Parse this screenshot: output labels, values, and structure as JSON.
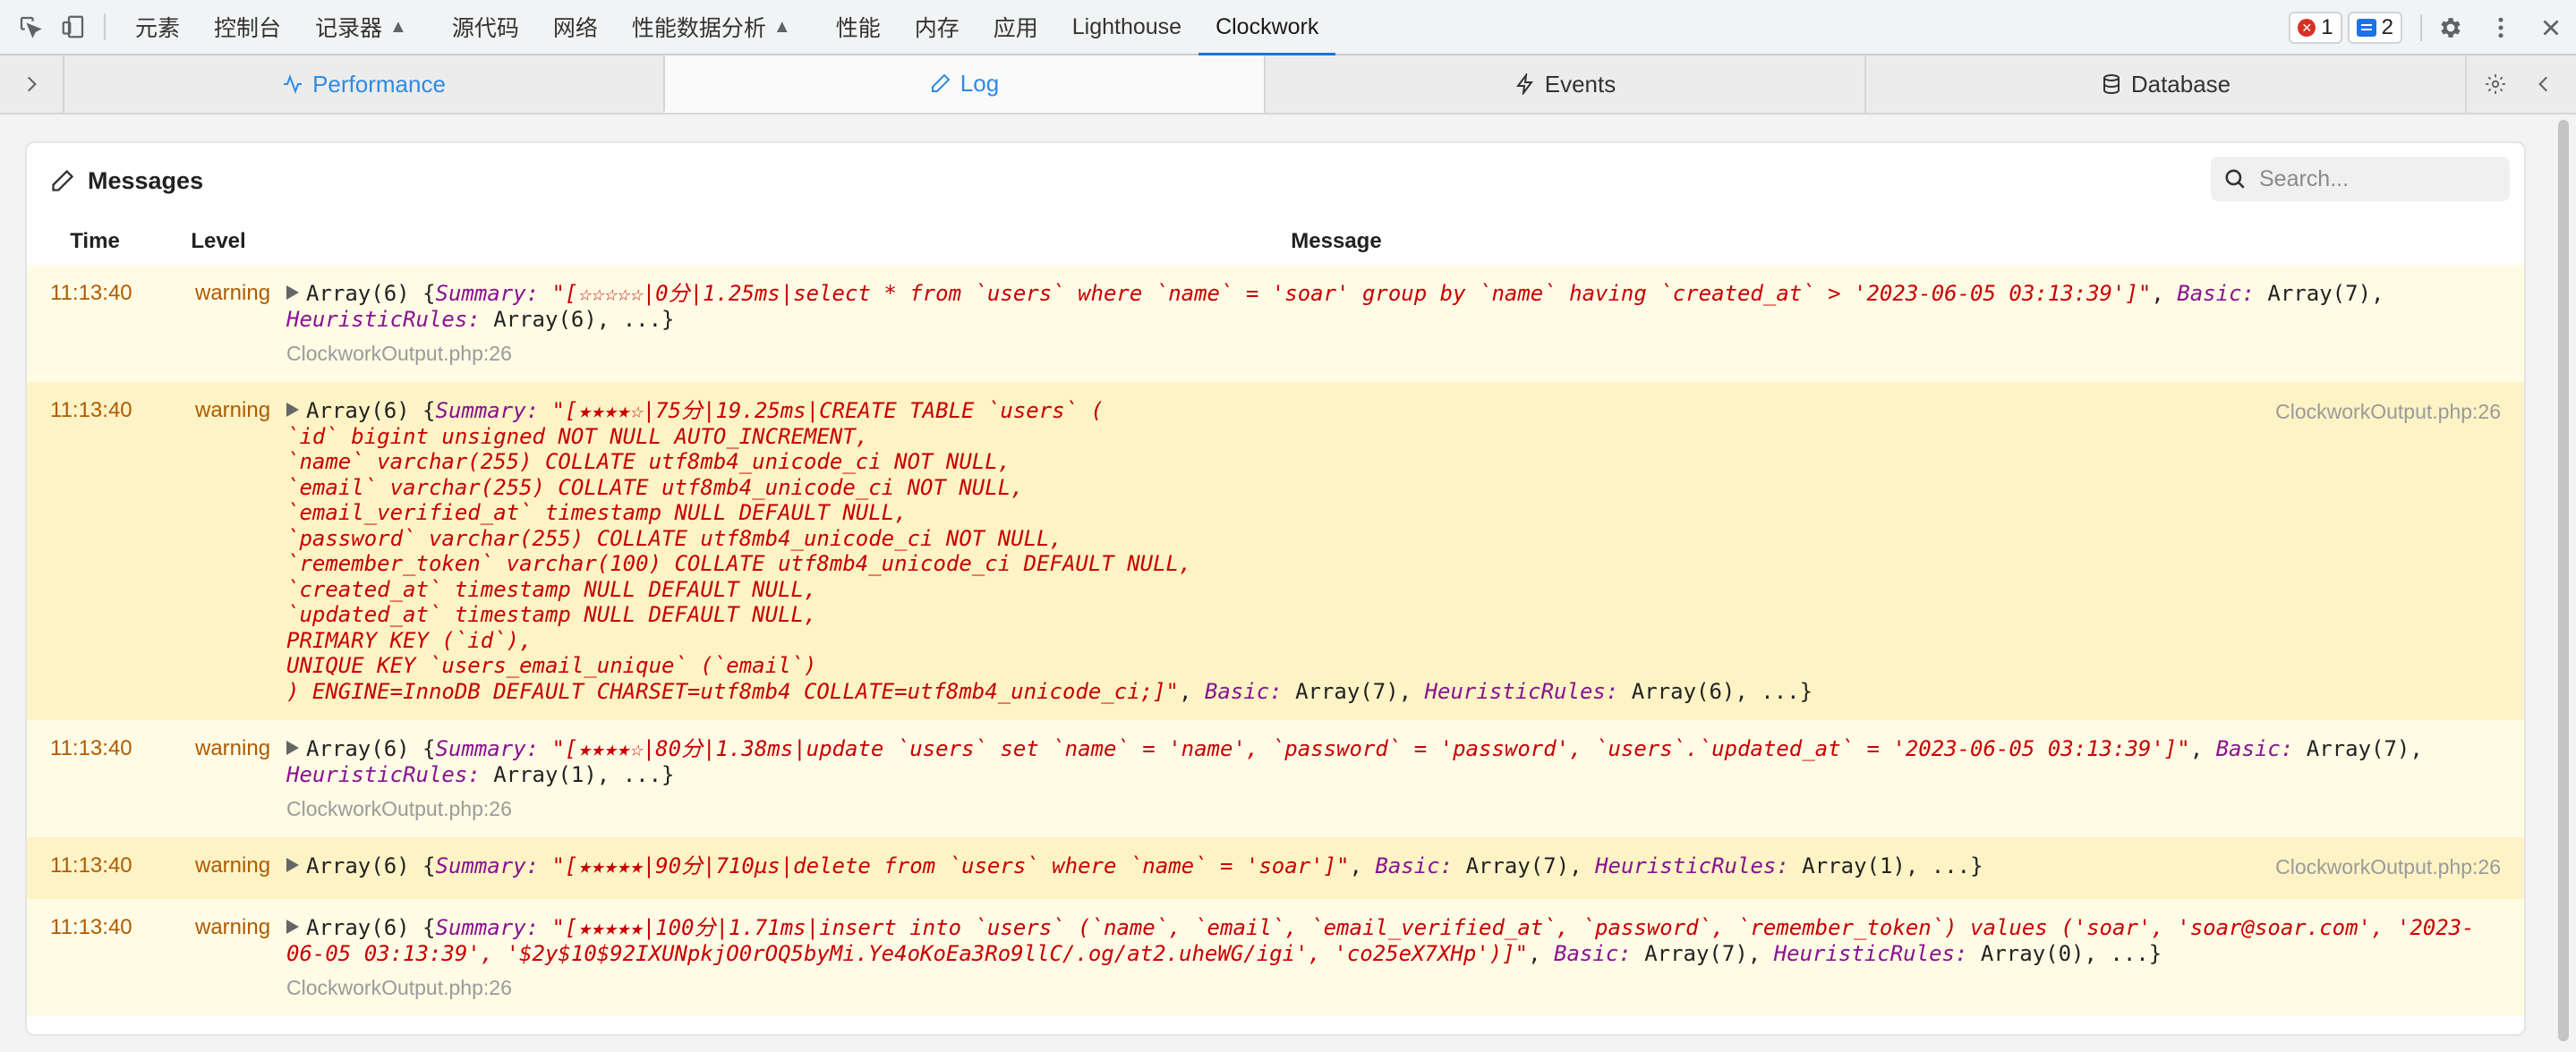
{
  "devtools": {
    "tabs": [
      "元素",
      "控制台",
      "记录器",
      "源代码",
      "网络",
      "性能数据分析",
      "性能",
      "内存",
      "应用",
      "Lighthouse",
      "Clockwork"
    ],
    "experimental_tabs": [
      "记录器",
      "性能数据分析"
    ],
    "active_tab": "Clockwork",
    "error_count": "1",
    "message_count": "2"
  },
  "clockwork": {
    "tabs": {
      "performance": "Performance",
      "log": "Log",
      "events": "Events",
      "database": "Database"
    }
  },
  "panel": {
    "title": "Messages",
    "search_placeholder": "Search...",
    "columns": {
      "time": "Time",
      "level": "Level",
      "message": "Message"
    }
  },
  "messages": [
    {
      "time": "11:13:40",
      "level": "warning",
      "prefix": "Array(6) {",
      "summary_key": "Summary:",
      "summary": "\"[☆☆☆☆☆|0分|1.25ms|select * from `users` where `name` = 'soar' group by `name` having `created_at` > '2023-06-05 03:13:39']\"",
      "basic_key": "Basic:",
      "basic_val": "Array(7),",
      "heuristic_key": "HeuristicRules:",
      "heuristic_val": "Array(6), ...}",
      "source": "ClockworkOutput.php:26"
    },
    {
      "time": "11:13:40",
      "level": "warning",
      "prefix": "Array(6) {",
      "summary_key": "Summary:",
      "summary": "\"[★★★★☆|75分|19.25ms|CREATE TABLE `users` (\n`id` bigint unsigned NOT NULL AUTO_INCREMENT,\n`name` varchar(255) COLLATE utf8mb4_unicode_ci NOT NULL,\n`email` varchar(255) COLLATE utf8mb4_unicode_ci NOT NULL,\n`email_verified_at` timestamp NULL DEFAULT NULL,\n`password` varchar(255) COLLATE utf8mb4_unicode_ci NOT NULL,\n`remember_token` varchar(100) COLLATE utf8mb4_unicode_ci DEFAULT NULL,\n`created_at` timestamp NULL DEFAULT NULL,\n`updated_at` timestamp NULL DEFAULT NULL,\nPRIMARY KEY (`id`),\nUNIQUE KEY `users_email_unique` (`email`)\n) ENGINE=InnoDB DEFAULT CHARSET=utf8mb4 COLLATE=utf8mb4_unicode_ci;]\"",
      "basic_key": "Basic:",
      "basic_val": "Array(7),",
      "heuristic_key": "HeuristicRules:",
      "heuristic_val": "Array(6), ...}",
      "source": "ClockworkOutput.php:26"
    },
    {
      "time": "11:13:40",
      "level": "warning",
      "prefix": "Array(6) {",
      "summary_key": "Summary:",
      "summary": "\"[★★★★☆|80分|1.38ms|update `users` set `name` = 'name', `password` = 'password', `users`.`updated_at` = '2023-06-05 03:13:39']\"",
      "basic_key": "Basic:",
      "basic_val": "Array(7),",
      "heuristic_key": "HeuristicRules:",
      "heuristic_val": "Array(1), ...}",
      "source": "ClockworkOutput.php:26"
    },
    {
      "time": "11:13:40",
      "level": "warning",
      "prefix": "Array(6) {",
      "summary_key": "Summary:",
      "summary": "\"[★★★★★|90分|710µs|delete from `users` where `name` = 'soar']\"",
      "basic_key": "Basic:",
      "basic_val": "Array(7),",
      "heuristic_key": "HeuristicRules:",
      "heuristic_val": "Array(1), ...}",
      "source": "ClockworkOutput.php:26"
    },
    {
      "time": "11:13:40",
      "level": "warning",
      "prefix": "Array(6) {",
      "summary_key": "Summary:",
      "summary": "\"[★★★★★|100分|1.71ms|insert into `users` (`name`, `email`, `email_verified_at`, `password`, `remember_token`) values ('soar', 'soar@soar.com', '2023-06-05 03:13:39', '$2y$10$92IXUNpkjO0rOQ5byMi.Ye4oKoEa3Ro9llC/.og/at2.uheWG/igi', 'co25eX7XHp')]\"",
      "basic_key": "Basic:",
      "basic_val": "Array(7),",
      "heuristic_key": "HeuristicRules:",
      "heuristic_val": "Array(0), ...}",
      "source": "ClockworkOutput.php:26"
    }
  ]
}
